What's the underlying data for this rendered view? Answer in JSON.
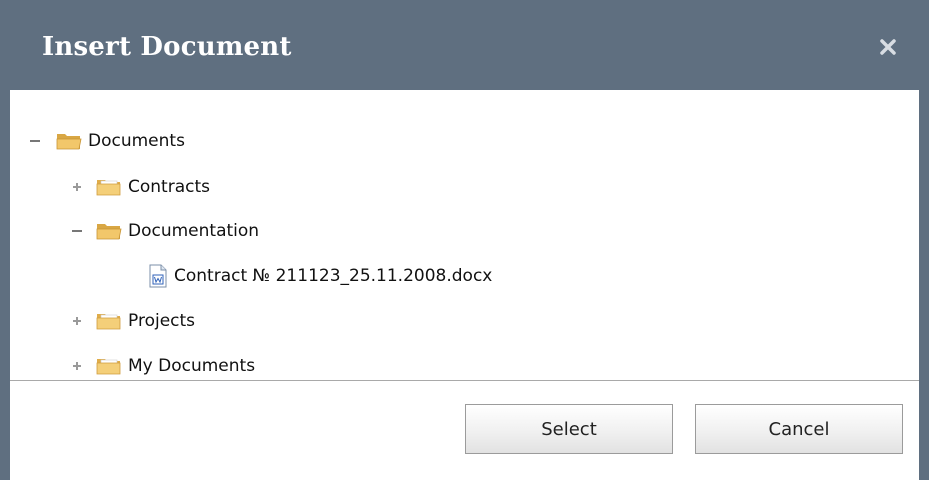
{
  "dialog": {
    "title": "Insert Document",
    "close_icon": "close-icon"
  },
  "tree": {
    "root": {
      "label": "Documents",
      "expanded": true,
      "icon": "open-folder-icon"
    },
    "items": [
      {
        "label": "Contracts",
        "expanded": false,
        "icon": "folder-icon"
      },
      {
        "label": "Documentation",
        "expanded": true,
        "icon": "open-folder-icon",
        "children": [
          {
            "label": "Contract № 211123_25.11.2008.docx",
            "icon": "word-document-icon"
          }
        ]
      },
      {
        "label": "Projects",
        "expanded": false,
        "icon": "folder-icon"
      },
      {
        "label": "My Documents",
        "expanded": false,
        "icon": "folder-icon"
      }
    ]
  },
  "buttons": {
    "select_label": "Select",
    "cancel_label": "Cancel"
  },
  "colors": {
    "titlebar": "#5f6f80",
    "folder": "#e8b64c"
  }
}
